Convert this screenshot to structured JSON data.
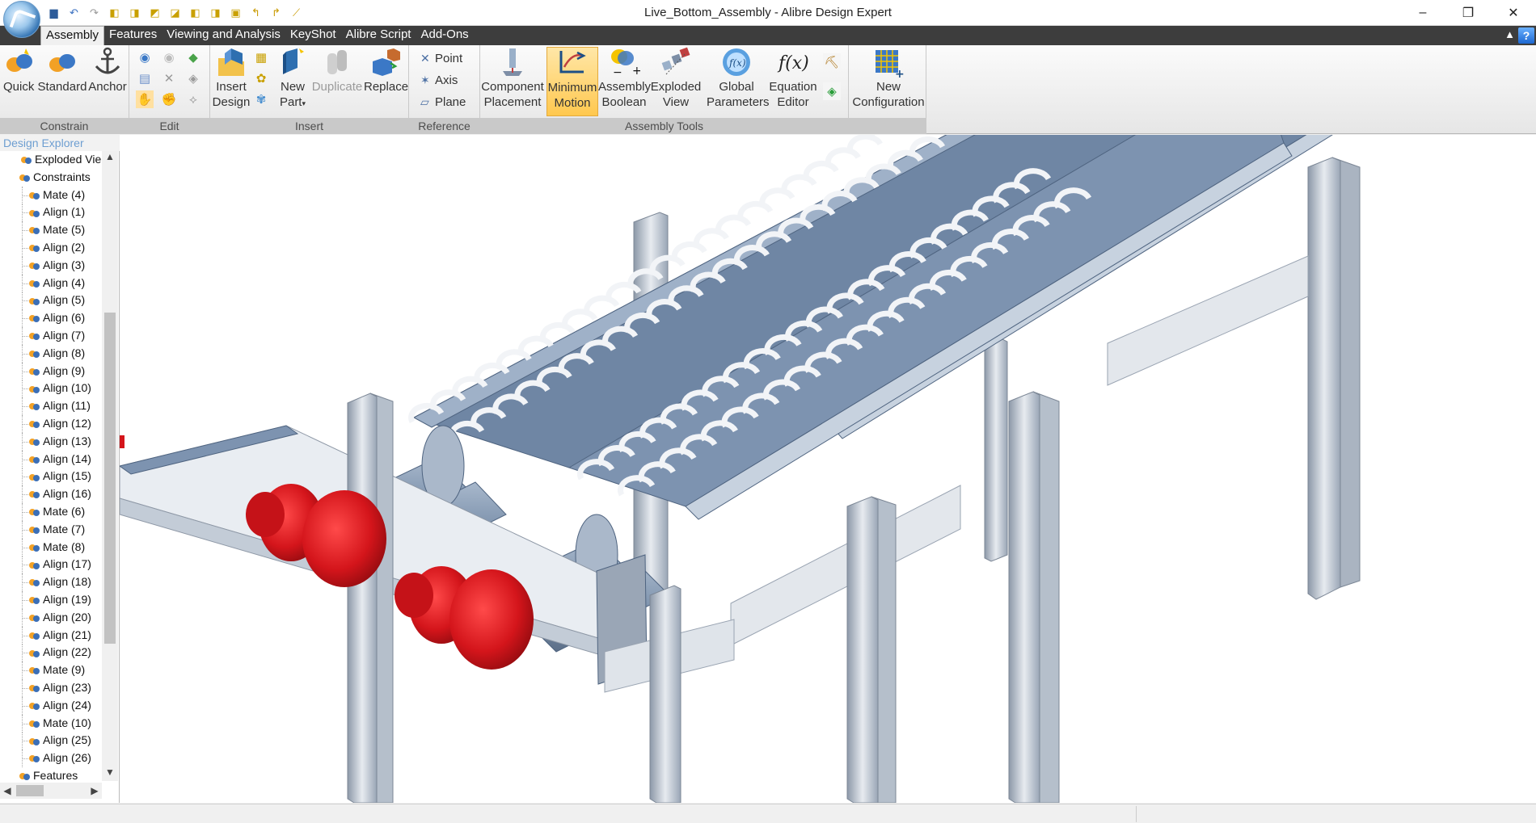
{
  "window": {
    "title": "Live_Bottom_Assembly - Alibre Design Expert",
    "minimize": "–",
    "restore": "❐",
    "close": "✕"
  },
  "menu": {
    "tabs": [
      "Assembly",
      "Features",
      "Viewing and Analysis",
      "KeyShot",
      "Alibre Script",
      "Add-Ons"
    ],
    "active": "Assembly",
    "help": "?"
  },
  "ribbon": {
    "constrain": {
      "label": "Constrain",
      "quick": "Quick",
      "standard": "Standard",
      "anchor": "Anchor"
    },
    "edit": {
      "label": "Edit"
    },
    "insert": {
      "label": "Insert",
      "insert_design": [
        "Insert",
        "Design"
      ],
      "new_part": [
        "New",
        "Part"
      ],
      "duplicate": "Duplicate",
      "replace": "Replace"
    },
    "reference": {
      "label": "Reference",
      "point": "Point",
      "axis": "Axis",
      "plane": "Plane"
    },
    "assembly_tools": {
      "label": "Assembly Tools",
      "component_placement": [
        "Component",
        "Placement"
      ],
      "minimum_motion": [
        "Minimum",
        "Motion"
      ],
      "assembly_boolean": [
        "Assembly",
        "Boolean"
      ],
      "exploded_view": [
        "Exploded",
        "View"
      ],
      "global_parameters": [
        "Global",
        "Parameters"
      ],
      "equation_editor": [
        "Equation",
        "Editor"
      ],
      "new_configuration": [
        "New",
        "Configuration"
      ]
    }
  },
  "design_explorer": {
    "title": "Design Explorer",
    "items": [
      {
        "label": "Exploded Vie",
        "level": 1
      },
      {
        "label": "Constraints",
        "level": 0
      },
      {
        "label": "Mate (4)",
        "level": 2
      },
      {
        "label": "Align (1)",
        "level": 2
      },
      {
        "label": "Mate (5)",
        "level": 2
      },
      {
        "label": "Align (2)",
        "level": 2
      },
      {
        "label": "Align (3)",
        "level": 2
      },
      {
        "label": "Align (4)",
        "level": 2
      },
      {
        "label": "Align (5)",
        "level": 2
      },
      {
        "label": "Align (6)",
        "level": 2
      },
      {
        "label": "Align (7)",
        "level": 2
      },
      {
        "label": "Align (8)",
        "level": 2
      },
      {
        "label": "Align (9)",
        "level": 2
      },
      {
        "label": "Align (10)",
        "level": 2
      },
      {
        "label": "Align (11)",
        "level": 2
      },
      {
        "label": "Align (12)",
        "level": 2
      },
      {
        "label": "Align (13)",
        "level": 2
      },
      {
        "label": "Align (14)",
        "level": 2
      },
      {
        "label": "Align (15)",
        "level": 2
      },
      {
        "label": "Align (16)",
        "level": 2
      },
      {
        "label": "Mate (6)",
        "level": 2
      },
      {
        "label": "Mate (7)",
        "level": 2
      },
      {
        "label": "Mate (8)",
        "level": 2
      },
      {
        "label": "Align (17)",
        "level": 2
      },
      {
        "label": "Align (18)",
        "level": 2
      },
      {
        "label": "Align (19)",
        "level": 2
      },
      {
        "label": "Align (20)",
        "level": 2
      },
      {
        "label": "Align (21)",
        "level": 2
      },
      {
        "label": "Align (22)",
        "level": 2
      },
      {
        "label": "Mate (9)",
        "level": 2
      },
      {
        "label": "Align (23)",
        "level": 2
      },
      {
        "label": "Align (24)",
        "level": 2
      },
      {
        "label": "Mate (10)",
        "level": 2
      },
      {
        "label": "Align (25)",
        "level": 2
      },
      {
        "label": "Align (26)",
        "level": 2
      },
      {
        "label": "Features",
        "level": 0
      }
    ]
  },
  "colors": {
    "accent_tab_bar": "#3d3d3d",
    "trough": "#7d93b0",
    "motor": "#d4151b",
    "steel": "#d9dde3"
  },
  "icons": {
    "qat": [
      "alibre-logo-icon",
      "save-icon",
      "undo-icon",
      "redo-icon",
      "cube-icon",
      "arrow-icon",
      "line-icon"
    ]
  }
}
